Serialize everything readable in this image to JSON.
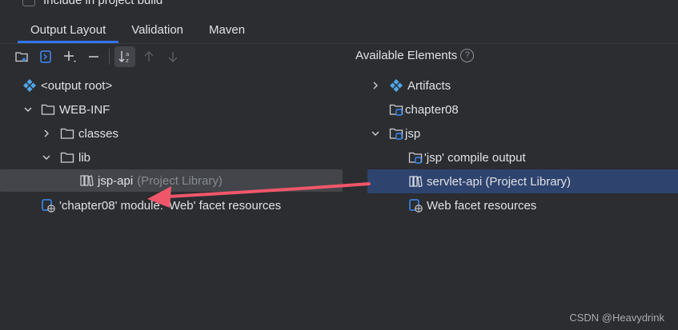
{
  "top_checkbox_label": "Include in project build",
  "tabs": [
    "Output Layout",
    "Validation",
    "Maven"
  ],
  "available_elements": {
    "title": "Available Elements",
    "help": "?"
  },
  "left_tree": {
    "output_root": "<output root>",
    "web_inf": "WEB-INF",
    "classes": "classes",
    "lib": "lib",
    "jsp_api": "jsp-api",
    "jsp_api_suffix": "(Project Library)",
    "facet_resources": "'chapter08' module: 'Web' facet resources"
  },
  "right_tree": {
    "artifacts": "Artifacts",
    "chapter08": "chapter08",
    "jsp": "jsp",
    "jsp_compile_output": "'jsp' compile output",
    "servlet_api": "servlet-api (Project Library)",
    "web_facet_resources": "Web facet resources"
  },
  "watermark": "CSDN @Heavydrink",
  "colors": {
    "background": "#2b2d30",
    "tab_underline": "#3574f0",
    "selection_left": "#43454a",
    "selection_right": "#2e436e",
    "arrow": "#f0566a",
    "module_icon": "#3d8bf7",
    "artifact_icon": "#4fa7e8"
  },
  "icons": {
    "toolbar": [
      "new-folder-icon",
      "artifact-icon",
      "add-icon",
      "remove-icon",
      "sort-icon",
      "move-up-icon",
      "move-down-icon"
    ]
  }
}
